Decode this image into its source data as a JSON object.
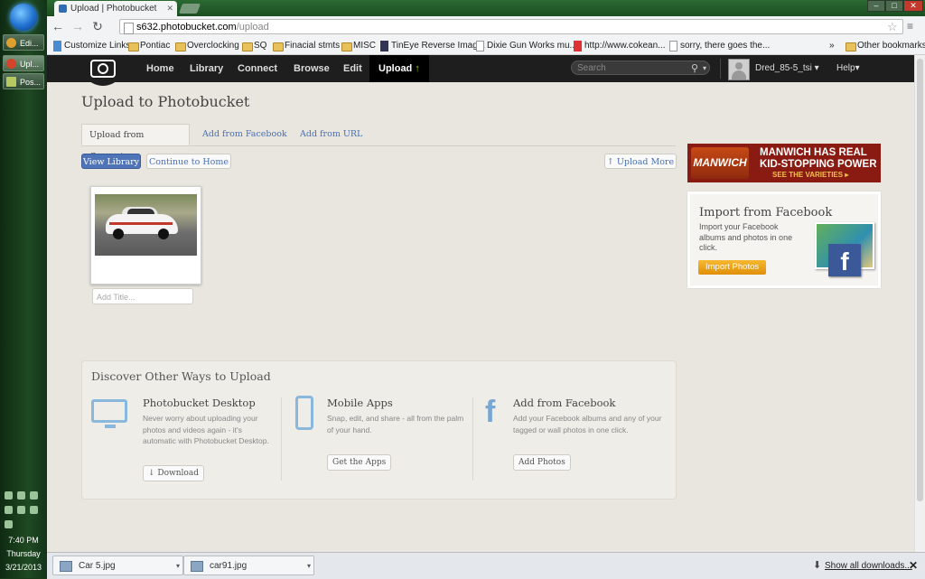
{
  "taskbar": {
    "items": [
      {
        "label": "Edi..."
      },
      {
        "label": "Upl..."
      },
      {
        "label": "Pos..."
      }
    ],
    "clock": {
      "time": "7:40 PM",
      "day": "Thursday",
      "date": "3/21/2013"
    }
  },
  "browser": {
    "tab_title": "Upload | Photobucket",
    "url_host": "s632.photobucket.com",
    "url_path": "/upload",
    "bookmarks": [
      "Customize Links",
      "Pontiac",
      "Overclocking",
      "SQ",
      "Finacial stmts",
      "MISC",
      "TinEye Reverse Imag...",
      "Dixie Gun Works mu...",
      "http://www.cokean...",
      "sorry, there goes the..."
    ],
    "bookmarks_overflow": "»",
    "other_bookmarks": "Other bookmarks"
  },
  "nav": {
    "links": [
      "Home",
      "Library",
      "Connect",
      "Browse",
      "Edit"
    ],
    "upload": "Upload",
    "search_placeholder": "Search",
    "username": "Dred_85-5_tsi",
    "help": "Help"
  },
  "page": {
    "title": "Upload to Photobucket",
    "tabs": [
      "Upload from Computer",
      "Add from Facebook",
      "Add from URL"
    ],
    "view_library": "View Library",
    "continue_home": "Continue to Home",
    "upload_more": "Upload More",
    "title_placeholder": "Add Title..."
  },
  "discover": {
    "heading": "Discover Other Ways to Upload",
    "desktop": {
      "title": "Photobucket Desktop",
      "desc": "Never worry about uploading your photos and videos again - it's automatic with Photobucket Desktop.",
      "button": "Download"
    },
    "mobile": {
      "title": "Mobile Apps",
      "desc": "Snap, edit, and share - all from the palm of your hand.",
      "button": "Get the Apps"
    },
    "facebook": {
      "title": "Add from Facebook",
      "desc": "Add your Facebook albums and any of your tagged or wall photos in one click.",
      "button": "Add Photos"
    }
  },
  "ad": {
    "brand": "MANWICH",
    "line1": "MANWICH HAS REAL",
    "line2": "KID-STOPPING POWER",
    "cta": "SEE THE VARIETIES ▸"
  },
  "import_facebook": {
    "title": "Import from Facebook",
    "desc": "Import your Facebook albums and photos in one click.",
    "button": "Import Photos"
  },
  "downloads": {
    "files": [
      "Car 5.jpg",
      "car91.jpg"
    ],
    "show_all": "Show all downloads...",
    "close": "✕"
  }
}
